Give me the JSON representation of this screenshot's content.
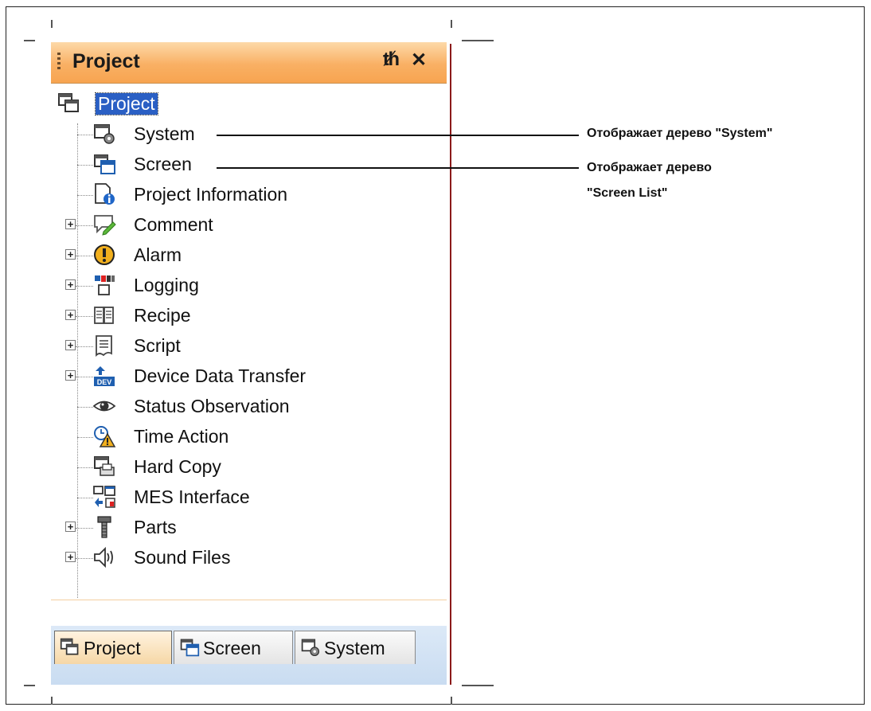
{
  "panel": {
    "title": "Project",
    "pin_icon": "pin-icon",
    "close_icon": "close-icon",
    "tree": {
      "root": "Project",
      "items": [
        {
          "label": "System",
          "icon": "system-icon",
          "expandable": false
        },
        {
          "label": "Screen",
          "icon": "screen-icon",
          "expandable": false
        },
        {
          "label": "Project Information",
          "icon": "info-icon",
          "expandable": false
        },
        {
          "label": "Comment",
          "icon": "comment-icon",
          "expandable": true
        },
        {
          "label": "Alarm",
          "icon": "alarm-icon",
          "expandable": true
        },
        {
          "label": "Logging",
          "icon": "logging-icon",
          "expandable": true
        },
        {
          "label": "Recipe",
          "icon": "recipe-icon",
          "expandable": true
        },
        {
          "label": "Script",
          "icon": "script-icon",
          "expandable": true
        },
        {
          "label": "Device Data Transfer",
          "icon": "device-transfer-icon",
          "expandable": true
        },
        {
          "label": "Status Observation",
          "icon": "eye-icon",
          "expandable": false
        },
        {
          "label": "Time Action",
          "icon": "time-action-icon",
          "expandable": false
        },
        {
          "label": "Hard Copy",
          "icon": "printer-icon",
          "expandable": false
        },
        {
          "label": "MES Interface",
          "icon": "mes-icon",
          "expandable": false
        },
        {
          "label": "Parts",
          "icon": "parts-icon",
          "expandable": true
        },
        {
          "label": "Sound Files",
          "icon": "speaker-icon",
          "expandable": true
        }
      ]
    },
    "tabs": [
      {
        "label": "Project",
        "active": true
      },
      {
        "label": "Screen",
        "active": false
      },
      {
        "label": "System",
        "active": false
      }
    ]
  },
  "callouts": {
    "system": "Отображает дерево \"System\"",
    "screen_line1": "Отображает дерево",
    "screen_line2": "\"Screen List\""
  },
  "colors": {
    "titlebar": "#f9b064",
    "selection": "#2a5fc4",
    "divider": "#8b1a1a"
  }
}
